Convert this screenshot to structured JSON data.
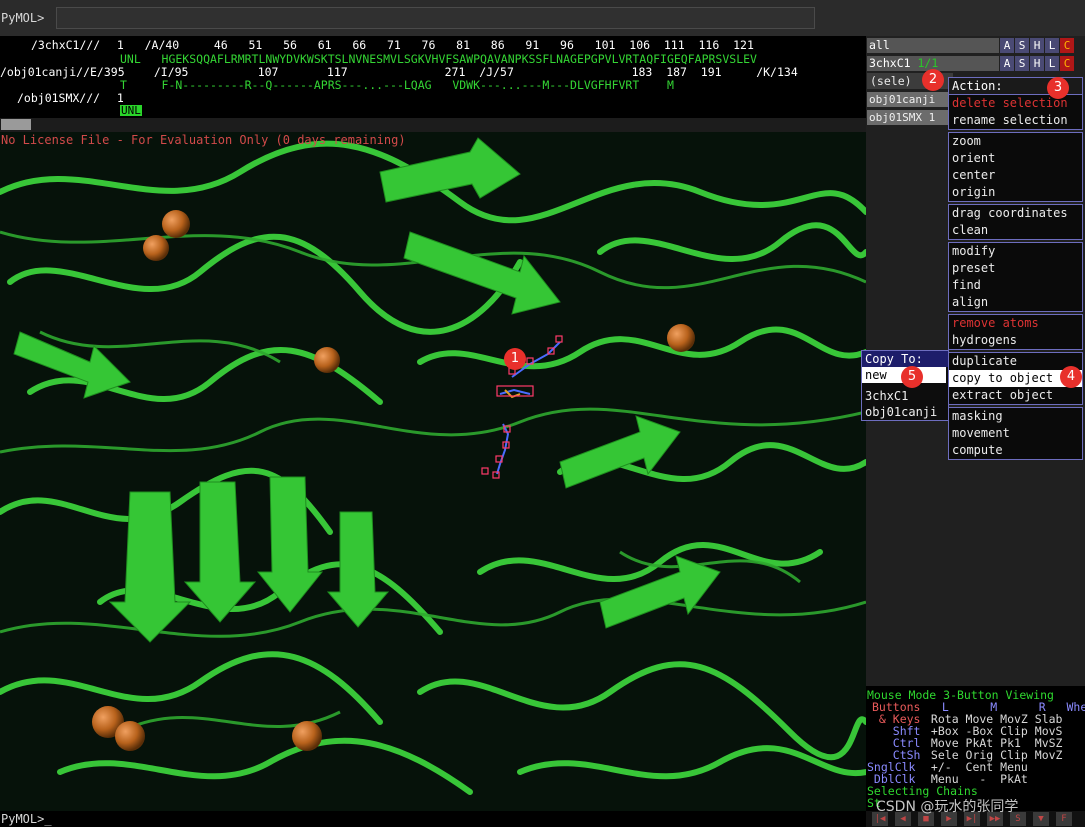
{
  "top": {
    "prompt": "PyMOL>"
  },
  "sequence": {
    "row1_label": "/3chxC1///",
    "row1_line": " 1   /A/40     46   51   56   61   66   71   76   81   86   91   96   101  106  111  116  121",
    "row1_seq": "UNL   HGEKSQQAFLRMRTLNWYDVKWSKTSLNVNESMVLSGKVHVFSAWPQAVANPKSSFLNAGEPGPVLVRTAQFIGEQFAPRSVSLEV",
    "row2_label": "/obj01canji//E/395",
    "row2_line": "  /I/95          107       117              271  /J/57                 183  187  191     /K/134",
    "row2_seq": "T     F-N---------R--Q------APRS---...---LQAG   VDWK---...---M---DLVGFHFVRT    M",
    "row3_label": "/obj01SMX///",
    "row3_line": " 1",
    "row3_res": "UNL"
  },
  "viewport": {
    "license_text": "No License File - For Evaluation Only (0 days remaining)",
    "atom_color": "#c86414",
    "cartoon_color": "#2ec82e"
  },
  "objects": [
    {
      "name": "all",
      "suffix": ""
    },
    {
      "name": "3chxC1",
      "suffix": "1/1"
    }
  ],
  "object_buttons": [
    "A",
    "S",
    "H",
    "L",
    "C"
  ],
  "sele_label": "(sele)",
  "side_objects": [
    "obj01canji",
    "obj01SMX 1"
  ],
  "action_menu": {
    "title": "Action:",
    "groups": [
      [
        {
          "label": "delete selection",
          "red": true
        },
        {
          "label": "rename selection"
        }
      ],
      [
        {
          "label": "zoom"
        },
        {
          "label": "orient"
        },
        {
          "label": "center"
        },
        {
          "label": "origin"
        }
      ],
      [
        {
          "label": "drag coordinates"
        },
        {
          "label": "clean"
        }
      ],
      [
        {
          "label": "modify"
        },
        {
          "label": "preset"
        },
        {
          "label": "find"
        },
        {
          "label": "align"
        }
      ],
      [
        {
          "label": "remove atoms",
          "red": true
        },
        {
          "label": "hydrogens"
        }
      ],
      [
        {
          "label": "duplicate"
        },
        {
          "label": "copy to object",
          "highlight": true
        },
        {
          "label": "extract object"
        }
      ],
      [
        {
          "label": "masking"
        },
        {
          "label": "movement"
        },
        {
          "label": "compute"
        }
      ]
    ]
  },
  "copy_menu": {
    "title": "Copy To:",
    "items": [
      "new",
      "3chxC1",
      "obj01canji"
    ]
  },
  "badges": [
    "1",
    "2",
    "3",
    "4",
    "5"
  ],
  "mouse_panel": {
    "line1": "Mouse Mode 3-Button Viewing",
    "line2_a": "Buttons",
    "line2_b": "  L      M      R   Wheel",
    "line3_a": " & Keys",
    "line3_b": " Rota Move MovZ Slab",
    "line4_a": "   Shft",
    "line4_b": " +Box -Box Clip MovS",
    "line5_a": "   Ctrl",
    "line5_b": " Move PkAt Pk1  MvSZ",
    "line6_a": "   CtSh",
    "line6_b": " Sele Orig Clip MovZ",
    "line7_a": "SnglClk",
    "line7_b": " +/-  Cent Menu",
    "line8_a": " DblClk",
    "line8_b": " Menu   -  PkAt",
    "line9": "Selecting Chains",
    "line10": "St"
  },
  "watermark": "CSDN @玩水的张同学",
  "bottom": {
    "prompt": "PyMOL>_"
  },
  "playbar": [
    "|◀",
    "◀",
    "■",
    "▶",
    "▶|",
    "▶▶",
    "S",
    "▼",
    "F"
  ]
}
